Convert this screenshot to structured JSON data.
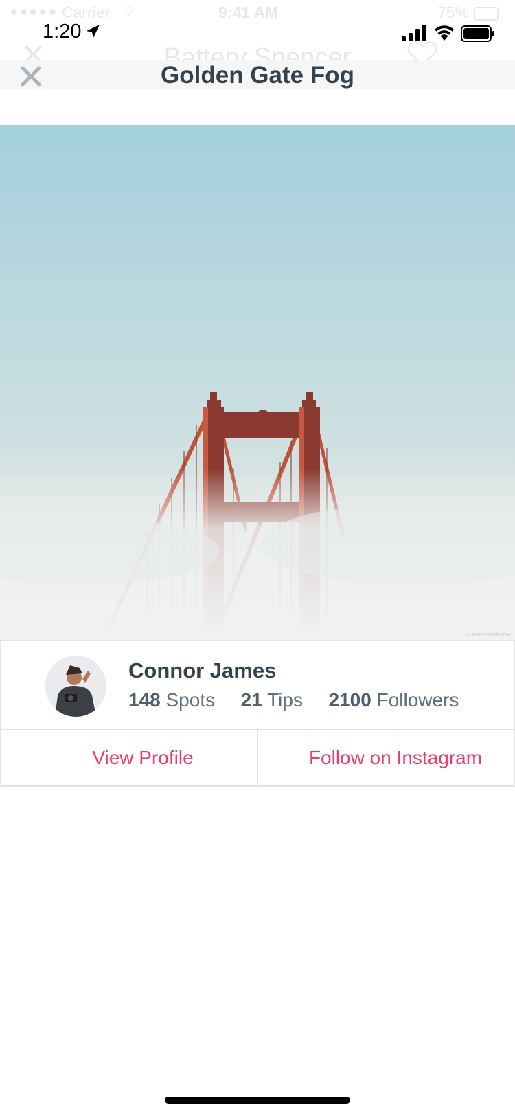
{
  "ghost_status_bar": {
    "signal": "●●●●●",
    "carrier": "Carrier",
    "wifi": "⌔",
    "time": "9:41 AM",
    "battery_percent": "75%"
  },
  "ghost_header": {
    "close": "✕",
    "title": "Battery Spencer"
  },
  "status_bar": {
    "time": "1:20"
  },
  "header": {
    "title": "Golden Gate Fog"
  },
  "photo": {
    "watermark": "INSIDEOUTOF.COM"
  },
  "profile": {
    "name": "Connor James",
    "spots_count": "148",
    "spots_label": "Spots",
    "tips_count": "21",
    "tips_label": "Tips",
    "followers_count": "2100",
    "followers_label": "Followers"
  },
  "actions": {
    "view_profile": "View Profile",
    "follow_instagram": "Follow on Instagram"
  },
  "colors": {
    "accent": "#ec3d6a",
    "title_text": "#33424c",
    "stats_text": "#5f6f7d",
    "border": "#e4e4e4",
    "close_icon": "#aab4bd"
  }
}
